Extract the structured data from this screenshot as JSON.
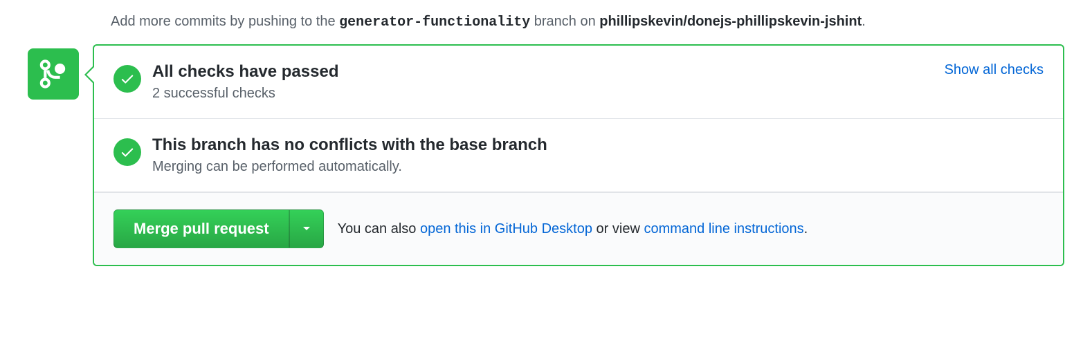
{
  "hint": {
    "prefix": "Add more commits by pushing to the ",
    "branch": "generator-functionality",
    "middle": " branch on ",
    "repo": "phillipskevin/donejs-phillipskevin-jshint",
    "suffix": "."
  },
  "checks": {
    "heading": "All checks have passed",
    "sub": "2 successful checks",
    "show_all_label": "Show all checks"
  },
  "conflicts": {
    "heading": "This branch has no conflicts with the base branch",
    "sub": "Merging can be performed automatically."
  },
  "merge": {
    "button_label": "Merge pull request",
    "help_prefix": "You can also ",
    "desktop_link": "open this in GitHub Desktop",
    "help_middle": " or view ",
    "cli_link": "command line instructions",
    "help_suffix": "."
  }
}
